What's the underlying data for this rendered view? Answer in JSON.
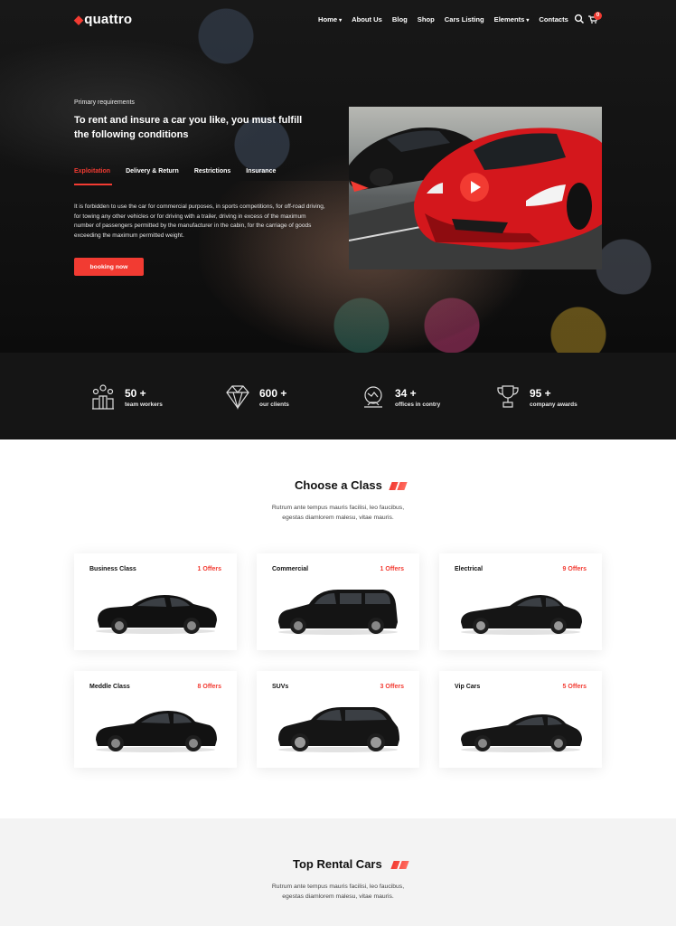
{
  "nav": {
    "logo": "quattro",
    "items": [
      {
        "label": "Home",
        "dropdown": true
      },
      {
        "label": "About Us",
        "dropdown": false
      },
      {
        "label": "Blog",
        "dropdown": false
      },
      {
        "label": "Shop",
        "dropdown": false
      },
      {
        "label": "Cars Listing",
        "dropdown": false
      },
      {
        "label": "Elements",
        "dropdown": true
      },
      {
        "label": "Contacts",
        "dropdown": false
      }
    ],
    "cart_count": "0",
    "icons": [
      "search-icon",
      "cart-icon"
    ]
  },
  "hero": {
    "eyebrow": "Primary requirements",
    "title": "To rent and insure a car you like, you must fulfill the following conditions",
    "tabs": [
      "Exploitation",
      "Delivery & Return",
      "Restrictions",
      "Insurance"
    ],
    "active_tab": 0,
    "text": "It is forbidden to use the car for commercial purposes, in sports competitions, for off-road driving, for towing any other vehicles or for driving with a trailer, driving in excess of the maximum number of passengers permitted by the manufacturer in the cabin, for the carriage of goods exceeding the maximum permitted weight.",
    "button": "booking now"
  },
  "stats": [
    {
      "value": "50 +",
      "label": "team workers",
      "icon": "team-icon"
    },
    {
      "value": "600 +",
      "label": "our clients",
      "icon": "diamond-icon"
    },
    {
      "value": "34 +",
      "label": "offices in contry",
      "icon": "globe-icon"
    },
    {
      "value": "95 +",
      "label": "company awards",
      "icon": "trophy-icon"
    }
  ],
  "classes": {
    "title": "Choose a Class",
    "subtitle_line1": "Rutrum ante tempus mauris facilisi, leo faucibus,",
    "subtitle_line2": "egestas diamlorem malesu, vitae mauris.",
    "cards": [
      {
        "name": "Business Class",
        "offers": "1 Offers"
      },
      {
        "name": "Commercial",
        "offers": "1 Offers"
      },
      {
        "name": "Electrical",
        "offers": "9 Offers"
      },
      {
        "name": "Meddle Class",
        "offers": "8 Offers"
      },
      {
        "name": "SUVs",
        "offers": "3 Offers"
      },
      {
        "name": "Vip Cars",
        "offers": "5 Offers"
      }
    ]
  },
  "top_rental": {
    "title": "Top Rental Cars",
    "subtitle_line1": "Rutrum ante tempus mauris facilisi, leo faucibus,",
    "subtitle_line2": "egestas diamlorem malesu, vitae mauris."
  },
  "colors": {
    "accent": "#f23b32",
    "dark": "#151515"
  }
}
